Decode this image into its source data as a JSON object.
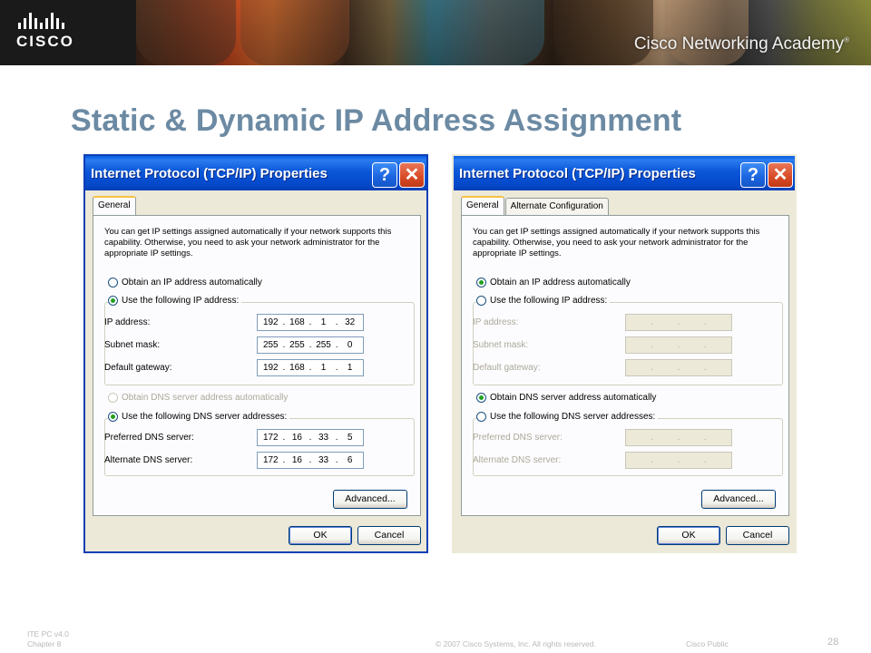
{
  "banner": {
    "logo_text": "CISCO",
    "academy_text": "Cisco Networking Academy",
    "trademark": "®"
  },
  "slide": {
    "title": "Static & Dynamic IP Address Assignment"
  },
  "dialog_static": {
    "title": "Internet Protocol (TCP/IP) Properties",
    "help_glyph": "?",
    "close_glyph": "✕",
    "tabs": [
      "General"
    ],
    "intro": "You can get IP settings assigned automatically if your network supports this capability. Otherwise, you need to ask your network administrator for the appropriate IP settings.",
    "radio_auto_ip": "Obtain an IP address automatically",
    "radio_manual_ip": "Use the following IP address:",
    "ip_label": "IP address:",
    "ip_value": [
      "192",
      "168",
      "1",
      "32"
    ],
    "mask_label": "Subnet mask:",
    "mask_value": [
      "255",
      "255",
      "255",
      "0"
    ],
    "gateway_label": "Default gateway:",
    "gateway_value": [
      "192",
      "168",
      "1",
      "1"
    ],
    "radio_auto_dns": "Obtain DNS server address automatically",
    "radio_manual_dns": "Use the following DNS server addresses:",
    "pref_dns_label": "Preferred DNS server:",
    "pref_dns_value": [
      "172",
      "16",
      "33",
      "5"
    ],
    "alt_dns_label": "Alternate DNS server:",
    "alt_dns_value": [
      "172",
      "16",
      "33",
      "6"
    ],
    "advanced_label": "Advanced...",
    "ok_label": "OK",
    "cancel_label": "Cancel"
  },
  "dialog_dynamic": {
    "title": "Internet Protocol (TCP/IP) Properties",
    "help_glyph": "?",
    "close_glyph": "✕",
    "tabs": [
      "General",
      "Alternate Configuration"
    ],
    "intro": "You can get IP settings assigned automatically if your network supports this capability. Otherwise, you need to ask your network administrator for the appropriate IP settings.",
    "radio_auto_ip": "Obtain an IP address automatically",
    "radio_manual_ip": "Use the following IP address:",
    "ip_label": "IP address:",
    "mask_label": "Subnet mask:",
    "gateway_label": "Default gateway:",
    "radio_auto_dns": "Obtain DNS server address automatically",
    "radio_manual_dns": "Use the following DNS server addresses:",
    "pref_dns_label": "Preferred DNS server:",
    "alt_dns_label": "Alternate DNS server:",
    "advanced_label": "Advanced...",
    "ok_label": "OK",
    "cancel_label": "Cancel"
  },
  "footer": {
    "course": "ITE PC v4.0",
    "chapter": "Chapter 8",
    "copyright": "© 2007 Cisco Systems, Inc. All rights reserved.",
    "classification": "Cisco Public",
    "page": "28"
  },
  "colors": {
    "title": "#6c8aa3",
    "xp_blue": "#0a56d8",
    "dialog_bg": "#ece9d8",
    "radio_on": "#21a121"
  }
}
